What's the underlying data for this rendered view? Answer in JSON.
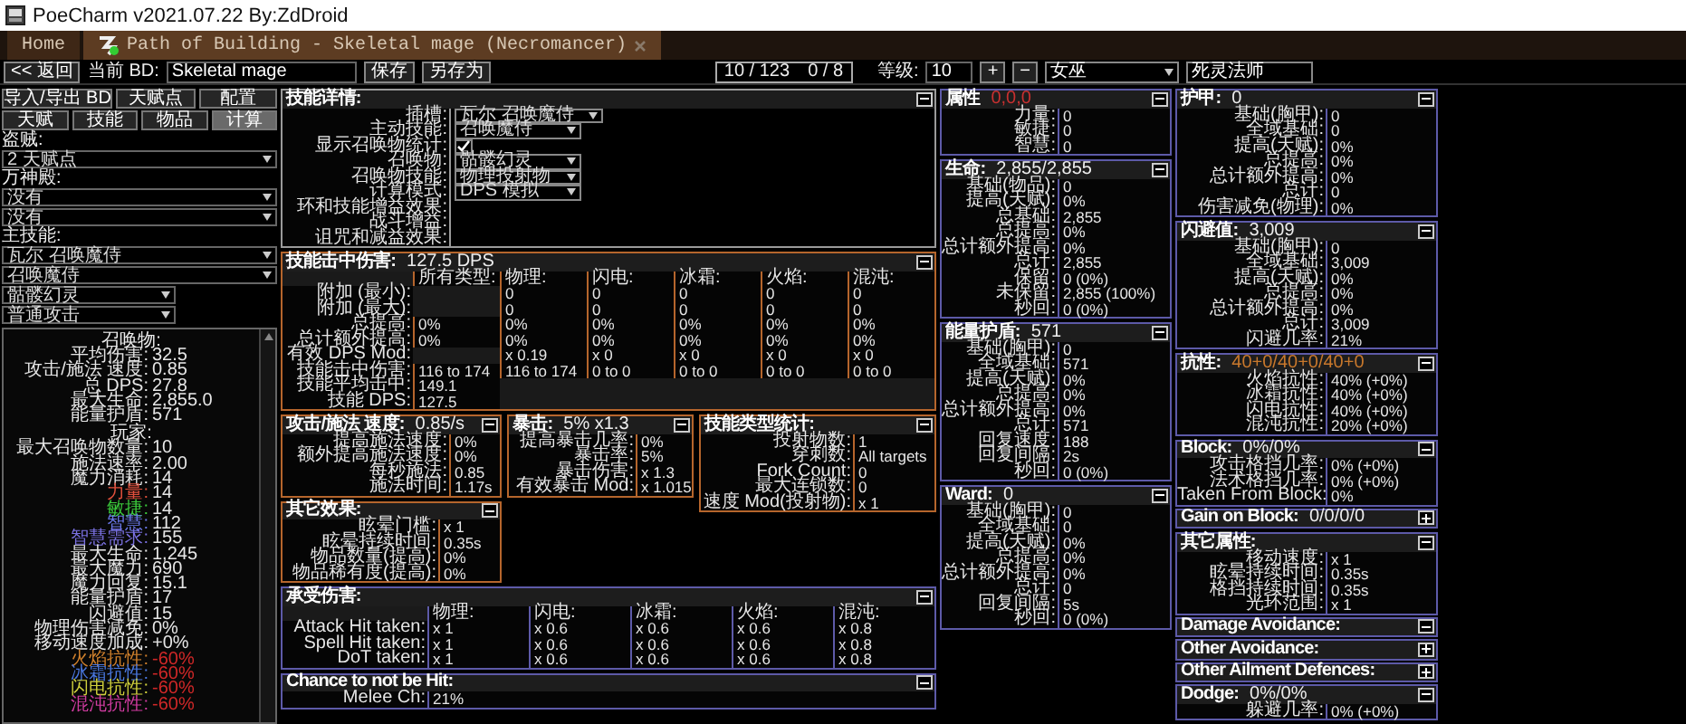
{
  "window": {
    "title": "PoeCharm v2021.07.22 By:ZdDroid"
  },
  "tabs": [
    {
      "label": "Home",
      "kind": "home",
      "selected": false
    },
    {
      "label": "Path of Building - Skeletal mage (Necromancer)",
      "kind": "document",
      "selected": true
    }
  ],
  "toolbar": {
    "back": "<< 返回",
    "current_label": "当前 BD:",
    "build_name": "Skeletal mage",
    "save": "保存",
    "save_as": "另存为",
    "points": "10 / 123",
    "ascendancy_points": "0 / 8",
    "level_label": "等级:",
    "level": "10",
    "level_up": "+",
    "level_down": "−",
    "class": "女巫",
    "ascendancy": "死灵法师"
  },
  "sidebar": {
    "buttons": [
      "导入/导出 BD",
      "天赋点",
      "配置"
    ],
    "tabs": [
      {
        "label": "天赋",
        "selected": false
      },
      {
        "label": "技能",
        "selected": false
      },
      {
        "label": "物品",
        "selected": false
      },
      {
        "label": "计算",
        "selected": true
      }
    ],
    "selectors": [
      {
        "label": "盗贼:",
        "dropdowns": [
          {
            "value": "2 天赋点",
            "kind": "full"
          }
        ]
      },
      {
        "label": "万神殿:",
        "dropdowns": [
          {
            "value": "没有",
            "kind": "full"
          },
          {
            "value": "没有",
            "kind": "full"
          }
        ]
      },
      {
        "label": "主技能:",
        "dropdowns": [
          {
            "value": "瓦尔 召唤魔侍",
            "kind": "full"
          },
          {
            "value": "召唤魔侍",
            "kind": "full"
          },
          {
            "value": "骷髅幻灵",
            "kind": "half"
          },
          {
            "value": "普通攻击",
            "kind": "half"
          }
        ]
      }
    ],
    "summary": [
      {
        "heading": "召唤物:",
        "stats": [
          {
            "label": "平均伤害:",
            "value": "32.5"
          },
          {
            "label": "攻击/施法 速度:",
            "value": "0.85"
          },
          {
            "label": "总 DPS:",
            "value": "27.8"
          },
          {
            "label": "最大生命:",
            "value": "2,855.0"
          },
          {
            "label": "能量护盾:",
            "value": "571"
          }
        ]
      },
      {
        "heading": "玩家:",
        "stats": [
          {
            "label": "最大召唤物数量:",
            "value": "10"
          },
          {
            "label": "施法速率:",
            "value": "2.00"
          },
          {
            "label": "魔力消耗:",
            "value": "14"
          },
          {
            "label": "力量:",
            "value": "14",
            "color": "#e0503c"
          },
          {
            "label": "敏捷:",
            "value": "14",
            "color": "#3ccc3c"
          },
          {
            "label": "智慧:",
            "value": "112",
            "color": "#6a78e8"
          },
          {
            "label": "智慧需求:",
            "value": "155",
            "color": "#7a70e0"
          },
          {
            "label": "最大生命:",
            "value": "1,245"
          },
          {
            "label": "最大魔力:",
            "value": "690"
          },
          {
            "label": "魔力回复:",
            "value": "15.1"
          },
          {
            "label": "能量护盾:",
            "value": "17"
          },
          {
            "label": "闪避值:",
            "value": "15"
          },
          {
            "label": "物理伤害减免:",
            "value": "0%"
          },
          {
            "label": "移动速度加成:",
            "value": "+0%"
          },
          {
            "label": "火焰抗性:",
            "value": "-60%",
            "color": "#d0802c",
            "kind": "resist"
          },
          {
            "label": "冰霜抗性:",
            "value": "-60%",
            "color": "#4a78e0",
            "kind": "resist"
          },
          {
            "label": "闪电抗性:",
            "value": "-60%",
            "color": "#d0d03c",
            "kind": "resist"
          },
          {
            "label": "混沌抗性:",
            "value": "-60%",
            "color": "#d03ca0",
            "kind": "resist"
          }
        ]
      }
    ]
  },
  "skill_details": {
    "title": "技能详情:",
    "color": "#9a9a9a",
    "expanded": true,
    "rows": [
      {
        "label": "插槽:",
        "kind": "dropdown",
        "value": "瓦尔 召唤魔侍"
      },
      {
        "label": "主动技能:",
        "kind": "dropdown",
        "value": "召唤魔侍"
      },
      {
        "label": "显示召唤物统计:",
        "kind": "checkbox",
        "checked": true
      },
      {
        "label": "召唤物:",
        "kind": "dropdown",
        "value": "骷髅幻灵"
      },
      {
        "label": "召唤物技能:",
        "kind": "dropdown",
        "value": "物理投射物"
      },
      {
        "label": "计算模式:",
        "kind": "dropdown",
        "value": "DPS 模拟"
      },
      {
        "label": "环和技能增益效果:",
        "kind": "none"
      },
      {
        "label": "战斗增益:",
        "kind": "none"
      },
      {
        "label": "诅咒和减益效果:",
        "kind": "none"
      }
    ]
  },
  "hit_damage": {
    "title": "技能击中伤害:",
    "value": "127.5 DPS",
    "color": "#b5652c",
    "expanded": true,
    "columns": [
      "所有类型:",
      "物理:",
      "闪电:",
      "冰霜:",
      "火焰:",
      "混沌:"
    ],
    "rows": [
      {
        "label": "附加 (最小):",
        "cells": [
          null,
          "0",
          "0",
          "0",
          "0",
          "0"
        ]
      },
      {
        "label": "附加 (最大):",
        "cells": [
          null,
          "0",
          "0",
          "0",
          "0",
          "0"
        ]
      },
      {
        "label": "总提高:",
        "cells": [
          "0%",
          "0%",
          "0%",
          "0%",
          "0%",
          "0%"
        ]
      },
      {
        "label": "总计额外提高:",
        "cells": [
          "0%",
          "0%",
          "0%",
          "0%",
          "0%",
          "0%"
        ]
      },
      {
        "label": "有效 DPS Mod:",
        "cells": [
          null,
          "x 0.19",
          "x 0",
          "x 0",
          "x 0",
          "x 0"
        ]
      },
      {
        "label": "技能击中伤害:",
        "cells": [
          "116 to 174",
          "116 to 174",
          "0 to 0",
          "0 to 0",
          "0 to 0",
          "0 to 0"
        ]
      },
      {
        "label": "技能平均击中:",
        "cells": [
          "149.1"
        ]
      },
      {
        "label": "技能 DPS:",
        "cells": [
          "127.5"
        ]
      }
    ]
  },
  "speed": {
    "title": "攻击/施法 速度:",
    "value": "0.85/s",
    "color": "#b5652c",
    "expanded": true,
    "rows": [
      {
        "label": "提高施法速度:",
        "value": "0%"
      },
      {
        "label": "额外提高施法速度:",
        "value": "0%"
      },
      {
        "label": "每秒施法:",
        "value": "0.85"
      },
      {
        "label": "施法时间:",
        "value": "1.17s"
      }
    ]
  },
  "crit": {
    "title": "暴击:",
    "value": "5% x1.3",
    "color": "#b5652c",
    "expanded": true,
    "rows": [
      {
        "label": "提高暴击几率:",
        "value": "0%"
      },
      {
        "label": "暴击率:",
        "value": "5%"
      },
      {
        "label": "暴击伤害:",
        "value": "x 1.3"
      },
      {
        "label": "有效暴击 Mod:",
        "value": "x 1.015"
      }
    ]
  },
  "skill_type": {
    "title": "技能类型统计:",
    "color": "#b5652c",
    "expanded": true,
    "rows": [
      {
        "label": "投射物数:",
        "value": "1"
      },
      {
        "label": "穿刺数:",
        "value": "All targets"
      },
      {
        "label": "Fork Count:",
        "value": "0"
      },
      {
        "label": "最大连锁数:",
        "value": "0"
      },
      {
        "label": "速度 Mod(投射物):",
        "value": "x 1"
      }
    ]
  },
  "other_effects": {
    "title": "其它效果:",
    "color": "#b5652c",
    "expanded": true,
    "rows": [
      {
        "label": "眩晕门槛:",
        "value": "x 1"
      },
      {
        "label": "眩晕持续时间:",
        "value": "0.35s"
      },
      {
        "label": "物品数量(提高):",
        "value": "0%"
      },
      {
        "label": "物品稀有度(提高):",
        "value": "0%"
      }
    ]
  },
  "damage_taken": {
    "title": "承受伤害:",
    "color": "#5d5aa8",
    "expanded": true,
    "columns": [
      "物理:",
      "闪电:",
      "冰霜:",
      "火焰:",
      "混沌:"
    ],
    "rows": [
      {
        "label": "Attack Hit taken:",
        "cells": [
          "x 1",
          "x 0.6",
          "x 0.6",
          "x 0.6",
          "x 0.8"
        ]
      },
      {
        "label": "Spell Hit taken:",
        "cells": [
          "x 1",
          "x 0.6",
          "x 0.6",
          "x 0.6",
          "x 0.8"
        ]
      },
      {
        "label": "DoT taken:",
        "cells": [
          "x 1",
          "x 0.6",
          "x 0.6",
          "x 0.6",
          "x 0.8"
        ]
      }
    ]
  },
  "not_hit": {
    "title": "Chance to not be Hit:",
    "color": "#5d5aa8",
    "expanded": true,
    "rows": [
      {
        "label": "Melee Ch:",
        "value": "21%"
      }
    ]
  },
  "defence_columns": [
    [
      [
        {
          "title": "属性",
          "value": "0,0,0",
          "kind": "alert",
          "color": "#5d5aa8",
          "expanded": true,
          "rows": [
            {
              "label": "力量:",
              "value": "0"
            },
            {
              "label": "敏捷:",
              "value": "0"
            },
            {
              "label": "智慧:",
              "value": "0"
            }
          ]
        }
      ],
      [
        {
          "title": "生命:",
          "value": "2,855/2,855",
          "color": "#5d5aa8",
          "expanded": true,
          "rows": [
            {
              "label": "基础(物品):",
              "value": "0"
            },
            {
              "label": "提高(天赋):",
              "value": "0%"
            },
            {
              "label": "总基础:",
              "value": "2,855"
            },
            {
              "label": "总提高:",
              "value": "0%"
            },
            {
              "label": "总计额外提高:",
              "value": "0%"
            },
            {
              "label": "总计:",
              "value": "2,855"
            },
            {
              "label": "保留:",
              "value": "0 (0%)"
            },
            {
              "label": "未保留:",
              "value": "2,855 (100%)"
            },
            {
              "label": "秒回:",
              "value": "0 (0%)"
            }
          ]
        }
      ],
      [
        {
          "title": "能量护盾:",
          "value": "571",
          "color": "#5d5aa8",
          "expanded": true,
          "rows": [
            {
              "label": "基础(胸甲):",
              "value": "0"
            },
            {
              "label": "全域基础:",
              "value": "571"
            },
            {
              "label": "提高(天赋):",
              "value": "0%"
            },
            {
              "label": "总提高:",
              "value": "0%"
            },
            {
              "label": "总计额外提高:",
              "value": "0%"
            },
            {
              "label": "总计:",
              "value": "571"
            },
            {
              "label": "回复速度:",
              "value": "188"
            },
            {
              "label": "回复间隔:",
              "value": "2s"
            },
            {
              "label": "秒回:",
              "value": "0 (0%)"
            }
          ]
        }
      ],
      [
        {
          "title": "Ward:",
          "value": "0",
          "color": "#5d5aa8",
          "expanded": true,
          "rows": [
            {
              "label": "基础(胸甲):",
              "value": "0"
            },
            {
              "label": "全域基础:",
              "value": "0"
            },
            {
              "label": "提高(天赋):",
              "value": "0%"
            },
            {
              "label": "总提高:",
              "value": "0%"
            },
            {
              "label": "总计额外提高:",
              "value": "0%"
            },
            {
              "label": "总计:",
              "value": "0"
            },
            {
              "label": "回复间隔:",
              "value": "5s"
            },
            {
              "label": "秒回:",
              "value": "0 (0%)"
            }
          ]
        }
      ]
    ],
    [
      [
        {
          "title": "护甲:",
          "value": "0",
          "color": "#5d5aa8",
          "expanded": true,
          "rows": [
            {
              "label": "基础(胸甲):",
              "value": "0"
            },
            {
              "label": "全域基础:",
              "value": "0"
            },
            {
              "label": "提高(天赋):",
              "value": "0%"
            },
            {
              "label": "总提高:",
              "value": "0%"
            },
            {
              "label": "总计额外提高:",
              "value": "0%"
            },
            {
              "label": "总计:",
              "value": "0"
            },
            {
              "label": "伤害减免(物理):",
              "value": "0%"
            }
          ]
        }
      ],
      [
        {
          "title": "闪避值:",
          "value": "3,009",
          "color": "#5d5aa8",
          "expanded": true,
          "rows": [
            {
              "label": "基础(胸甲):",
              "value": "0"
            },
            {
              "label": "全域基础:",
              "value": "3,009"
            },
            {
              "label": "提高(天赋):",
              "value": "0%"
            },
            {
              "label": "总提高:",
              "value": "0%"
            },
            {
              "label": "总计额外提高:",
              "value": "0%"
            },
            {
              "label": "总计:",
              "value": "3,009"
            },
            {
              "label": "闪避几率:",
              "value": "21%"
            }
          ]
        }
      ],
      [
        {
          "title": "抗性:",
          "value": "40+0/40+0/40+0",
          "kind": "resist",
          "color": "#5d5aa8",
          "expanded": true,
          "rows": [
            {
              "label": "火焰抗性:",
              "value": "40% (+0%)"
            },
            {
              "label": "冰霜抗性:",
              "value": "40% (+0%)"
            },
            {
              "label": "闪电抗性:",
              "value": "40% (+0%)"
            },
            {
              "label": "混沌抗性:",
              "value": "20% (+0%)"
            }
          ]
        }
      ],
      [
        {
          "title": "Block:",
          "value": "0%/0%",
          "color": "#5d5aa8",
          "expanded": true,
          "rows": [
            {
              "label": "攻击格挡几率:",
              "value": "0% (+0%)"
            },
            {
              "label": "法术格挡几率:",
              "value": "0% (+0%)"
            },
            {
              "label": "Taken From Block:",
              "value": "0%"
            }
          ]
        },
        {
          "title": "Gain on Block:",
          "value": "0/0/0/0",
          "color": "#5d5aa8",
          "expanded": false
        }
      ],
      [
        {
          "title": "其它属性:",
          "color": "#5d5aa8",
          "expanded": true,
          "rows": [
            {
              "label": "移动速度:",
              "value": "x 1"
            },
            {
              "label": "眩晕持续时间:",
              "value": "0.35s"
            },
            {
              "label": "格挡持续时间:",
              "value": "0.35s"
            },
            {
              "label": "光环范围:",
              "value": "x 1"
            }
          ]
        },
        {
          "title": "Damage Avoidance:",
          "color": "#5d5aa8",
          "expanded": true
        },
        {
          "title": "Other Avoidance:",
          "color": "#5d5aa8",
          "expanded": false
        },
        {
          "title": "Other Ailment Defences:",
          "color": "#5d5aa8",
          "expanded": false
        },
        {
          "title": "Dodge:",
          "value": "0%/0%",
          "color": "#5d5aa8",
          "expanded": true,
          "rows": [
            {
              "label": "躲避几率:",
              "value": "0% (+0%)"
            }
          ]
        }
      ]
    ]
  ]
}
